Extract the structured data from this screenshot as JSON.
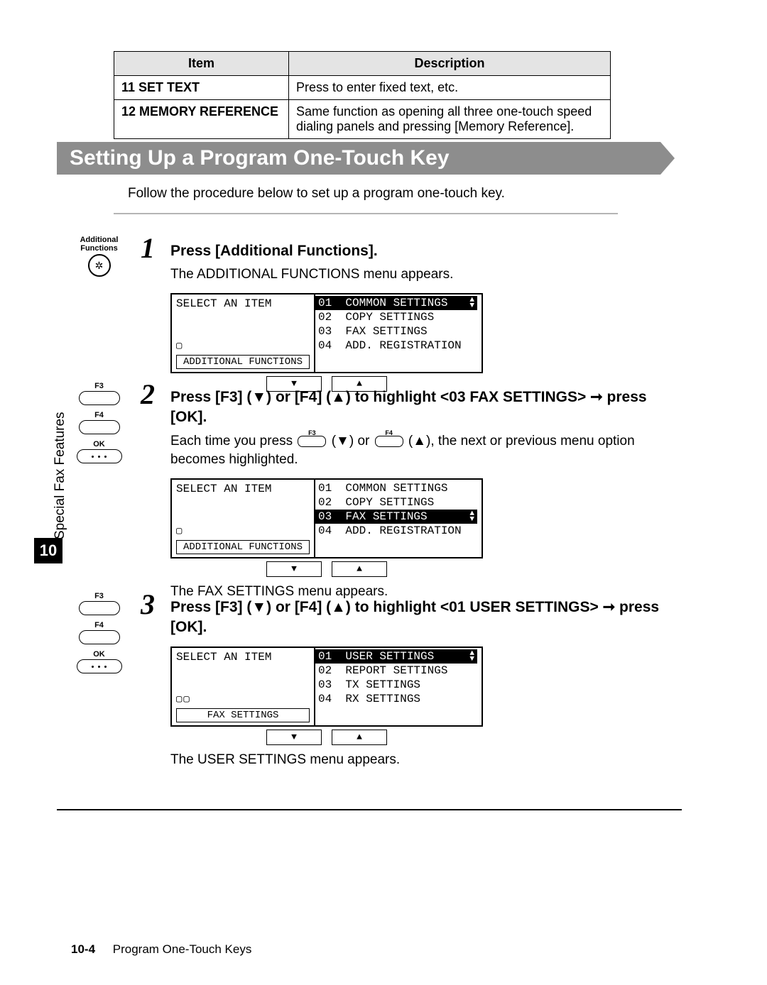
{
  "table": {
    "headers": {
      "item": "Item",
      "desc": "Description"
    },
    "rows": [
      {
        "item": "11 SET TEXT",
        "desc": "Press to enter fixed text, etc."
      },
      {
        "item": "12 MEMORY REFERENCE",
        "desc": "Same function as opening all three one-touch speed dialing panels and pressing [Memory Reference]."
      }
    ]
  },
  "section": {
    "title": "Setting Up a Program One-Touch Key",
    "intro": "Follow the procedure below to set up a program one-touch key."
  },
  "sidebar": {
    "label": "Special Fax Features",
    "chapter": "10"
  },
  "keys": {
    "additional_functions": "Additional Functions",
    "f3": "F3",
    "f4": "F4",
    "ok": "OK"
  },
  "steps": [
    {
      "num": "1",
      "title": "Press [Additional Functions].",
      "body": "The ADDITIONAL FUNCTIONS menu appears.",
      "lcd": {
        "left_title": "SELECT AN ITEM",
        "breadcrumb": "▢",
        "context": "ADDITIONAL FUNCTIONS",
        "rows": [
          {
            "text": "01  COMMON SETTINGS",
            "sel": true
          },
          {
            "text": "02  COPY SETTINGS",
            "sel": false
          },
          {
            "text": "03  FAX SETTINGS",
            "sel": false
          },
          {
            "text": "04  ADD. REGISTRATION",
            "sel": false
          }
        ]
      }
    },
    {
      "num": "2",
      "title_parts": {
        "a": "Press [F3] (▼) or [F4] (▲) to highlight <03 FAX SETTINGS> ➞ press [OK].",
        "body_pre": "Each time you press ",
        "body_mid": " (▼) or ",
        "body_post": " (▲), the next or previous menu option becomes highlighted."
      },
      "lcd": {
        "left_title": "SELECT AN ITEM",
        "breadcrumb": "▢",
        "context": "ADDITIONAL FUNCTIONS",
        "rows": [
          {
            "text": "01  COMMON SETTINGS",
            "sel": false
          },
          {
            "text": "02  COPY SETTINGS",
            "sel": false
          },
          {
            "text": "03  FAX SETTINGS",
            "sel": true
          },
          {
            "text": "04  ADD. REGISTRATION",
            "sel": false
          }
        ]
      },
      "caption": "The FAX SETTINGS menu appears."
    },
    {
      "num": "3",
      "title": "Press [F3] (▼) or [F4] (▲) to highlight <01 USER SETTINGS> ➞ press [OK].",
      "lcd": {
        "left_title": "SELECT AN ITEM",
        "breadcrumb": "▢▢",
        "context": "FAX SETTINGS",
        "rows": [
          {
            "text": "01  USER SETTINGS",
            "sel": true
          },
          {
            "text": "02  REPORT SETTINGS",
            "sel": false
          },
          {
            "text": "03  TX SETTINGS",
            "sel": false
          },
          {
            "text": "04  RX SETTINGS",
            "sel": false
          }
        ]
      },
      "caption": "The USER SETTINGS menu appears."
    }
  ],
  "footer": {
    "page": "10-4",
    "title": "Program One-Touch Keys"
  },
  "glyphs": {
    "down": "▼",
    "up": "▲",
    "updown": "▲▼"
  }
}
